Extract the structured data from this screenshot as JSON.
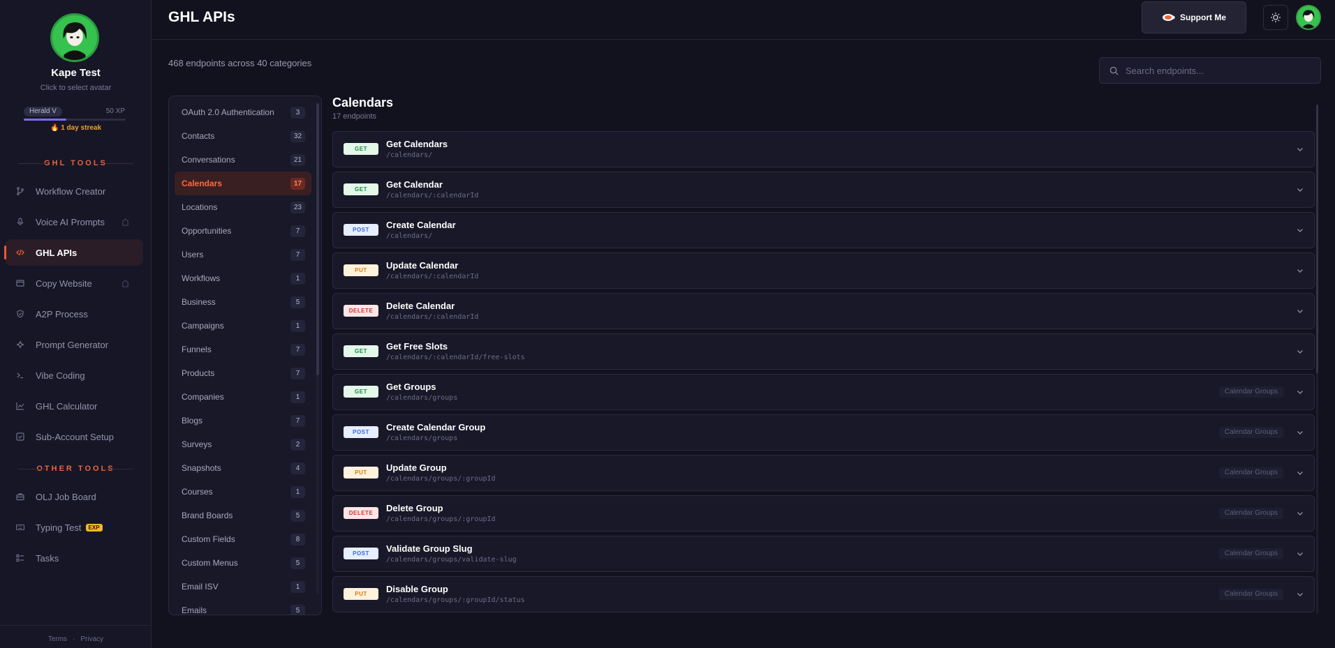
{
  "user": {
    "name": "Kape Test",
    "hint": "Click to select avatar",
    "level": "Herald V",
    "xp": "50 XP",
    "xp_progress": 0.42,
    "streak": "1 day streak"
  },
  "sidebar": {
    "ghl_tools_title": "GHL TOOLS",
    "other_tools_title": "OTHER TOOLS",
    "items": [
      {
        "label": "Workflow Creator",
        "icon": "branch-icon"
      },
      {
        "label": "Voice AI Prompts",
        "icon": "mic-icon",
        "locked": true
      },
      {
        "label": "GHL APIs",
        "icon": "code-icon",
        "active": true
      },
      {
        "label": "Copy Website",
        "icon": "window-icon",
        "locked": true
      },
      {
        "label": "A2P Process",
        "icon": "shield-icon"
      },
      {
        "label": "Prompt Generator",
        "icon": "sparkle-icon"
      },
      {
        "label": "Vibe Coding",
        "icon": "terminal-icon"
      },
      {
        "label": "GHL Calculator",
        "icon": "chart-icon"
      },
      {
        "label": "Sub-Account Setup",
        "icon": "checkbox-icon"
      }
    ],
    "other_items": [
      {
        "label": "OLJ Job Board",
        "icon": "briefcase-icon"
      },
      {
        "label": "Typing Test",
        "icon": "keyboard-icon",
        "badge": "EXP"
      },
      {
        "label": "Tasks",
        "icon": "tasks-icon"
      }
    ],
    "footer": {
      "terms": "Terms",
      "sep": "·",
      "privacy": "Privacy"
    }
  },
  "header": {
    "title": "GHL APIs",
    "support_label": "Support Me"
  },
  "summary": "468 endpoints across 40 categories",
  "search": {
    "placeholder": "Search endpoints..."
  },
  "categories": [
    {
      "label": "OAuth 2.0 Authentication",
      "count": "3"
    },
    {
      "label": "Contacts",
      "count": "32"
    },
    {
      "label": "Conversations",
      "count": "21"
    },
    {
      "label": "Calendars",
      "count": "17",
      "active": true
    },
    {
      "label": "Locations",
      "count": "23"
    },
    {
      "label": "Opportunities",
      "count": "7"
    },
    {
      "label": "Users",
      "count": "7"
    },
    {
      "label": "Workflows",
      "count": "1"
    },
    {
      "label": "Business",
      "count": "5"
    },
    {
      "label": "Campaigns",
      "count": "1"
    },
    {
      "label": "Funnels",
      "count": "7"
    },
    {
      "label": "Products",
      "count": "7"
    },
    {
      "label": "Companies",
      "count": "1"
    },
    {
      "label": "Blogs",
      "count": "7"
    },
    {
      "label": "Surveys",
      "count": "2"
    },
    {
      "label": "Snapshots",
      "count": "4"
    },
    {
      "label": "Courses",
      "count": "1"
    },
    {
      "label": "Brand Boards",
      "count": "5"
    },
    {
      "label": "Custom Fields",
      "count": "8"
    },
    {
      "label": "Custom Menus",
      "count": "5"
    },
    {
      "label": "Email ISV",
      "count": "1"
    },
    {
      "label": "Emails",
      "count": "5"
    }
  ],
  "endpoints_section": {
    "title": "Calendars",
    "subtitle": "17 endpoints"
  },
  "endpoints": [
    {
      "method": "GET",
      "name": "Get Calendars",
      "path": "/calendars/",
      "tag": ""
    },
    {
      "method": "GET",
      "name": "Get Calendar",
      "path": "/calendars/:calendarId",
      "tag": ""
    },
    {
      "method": "POST",
      "name": "Create Calendar",
      "path": "/calendars/",
      "tag": ""
    },
    {
      "method": "PUT",
      "name": "Update Calendar",
      "path": "/calendars/:calendarId",
      "tag": ""
    },
    {
      "method": "DELETE",
      "name": "Delete Calendar",
      "path": "/calendars/:calendarId",
      "tag": ""
    },
    {
      "method": "GET",
      "name": "Get Free Slots",
      "path": "/calendars/:calendarId/free-slots",
      "tag": ""
    },
    {
      "method": "GET",
      "name": "Get Groups",
      "path": "/calendars/groups",
      "tag": "Calendar Groups"
    },
    {
      "method": "POST",
      "name": "Create Calendar Group",
      "path": "/calendars/groups",
      "tag": "Calendar Groups"
    },
    {
      "method": "PUT",
      "name": "Update Group",
      "path": "/calendars/groups/:groupId",
      "tag": "Calendar Groups"
    },
    {
      "method": "DELETE",
      "name": "Delete Group",
      "path": "/calendars/groups/:groupId",
      "tag": "Calendar Groups"
    },
    {
      "method": "POST",
      "name": "Validate Group Slug",
      "path": "/calendars/groups/validate-slug",
      "tag": "Calendar Groups"
    },
    {
      "method": "PUT",
      "name": "Disable Group",
      "path": "/calendars/groups/:groupId/status",
      "tag": "Calendar Groups"
    }
  ],
  "colors": {
    "accent": "#ef5a2f",
    "background": "#12121f",
    "panel": "#181829",
    "xp": "#7c6cf0"
  }
}
